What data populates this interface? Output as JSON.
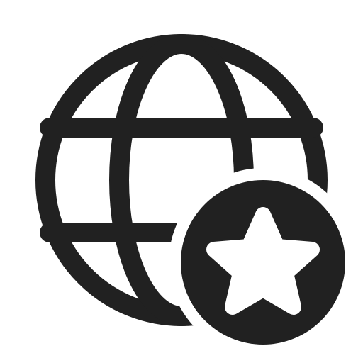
{
  "icon": {
    "name": "globe-star-icon",
    "parts": [
      "globe-icon",
      "star-badge-icon",
      "star-icon"
    ],
    "colors": {
      "ink": "#212121",
      "background": "#ffffff"
    }
  }
}
